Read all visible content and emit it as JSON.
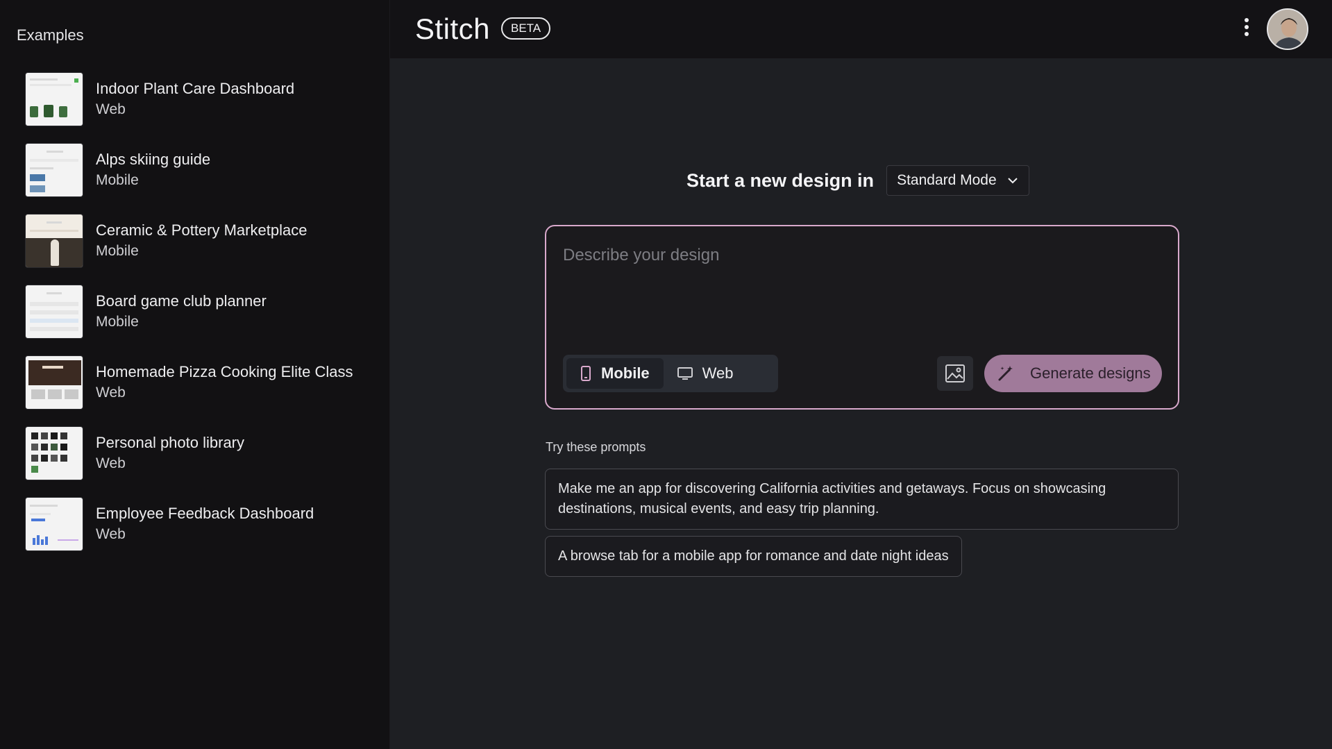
{
  "sidebar": {
    "title": "Examples",
    "items": [
      {
        "title": "Indoor Plant Care Dashboard",
        "type": "Web"
      },
      {
        "title": "Alps skiing guide",
        "type": "Mobile"
      },
      {
        "title": "Ceramic & Pottery Marketplace",
        "type": "Mobile"
      },
      {
        "title": "Board game club planner",
        "type": "Mobile"
      },
      {
        "title": "Homemade Pizza Cooking Elite Class",
        "type": "Web"
      },
      {
        "title": "Personal photo library",
        "type": "Web"
      },
      {
        "title": "Employee Feedback Dashboard",
        "type": "Web"
      }
    ]
  },
  "header": {
    "logo": "Stitch",
    "badge": "BETA"
  },
  "main": {
    "start_text": "Start a new design in",
    "mode_selected": "Standard Mode",
    "prompt_placeholder": "Describe your design",
    "device_options": [
      "Mobile",
      "Web"
    ],
    "device_selected": "Mobile",
    "generate_label": "Generate designs",
    "try_label": "Try these prompts",
    "prompts": [
      "Make me an app for discovering California activities and getaways. Focus on showcasing destinations, musical events, and easy trip planning.",
      "A browse tab for a mobile app for romance and date night ideas"
    ]
  },
  "colors": {
    "accent": "#d9a9cc",
    "generate_button": "#a07a9a"
  }
}
